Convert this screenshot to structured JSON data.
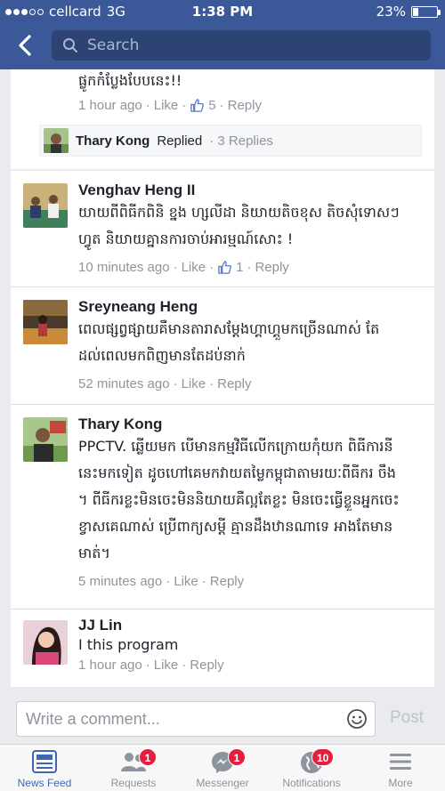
{
  "status_bar": {
    "carrier": "cellcard",
    "network": "3G",
    "time": "1:38 PM",
    "battery": "23%",
    "battery_level": 0.23
  },
  "search": {
    "placeholder": "Search"
  },
  "top_comment": {
    "text_tail": "ផ្លូកកំប្លែងបែបនេះ!!",
    "time": "1 hour ago",
    "like_label": "Like",
    "like_count": "5",
    "reply_label": "Reply",
    "replied": {
      "name": "Thary Kong",
      "action": "Replied",
      "count": "3 Replies"
    }
  },
  "comments": [
    {
      "name": "Venghav Heng II",
      "lines": [
        "យាយពីពិធីកពិនិ ខ្នង ហ្សលីដា និយាយតិចខុស តិចសុំទោសៗ",
        "ហ្វូត និយាយគ្នានការចាប់អារម្មណ៍សោះ !"
      ],
      "time": "10 minutes ago",
      "like_label": "Like",
      "like_count": "1",
      "reply_label": "Reply"
    },
    {
      "name": "Sreyneang Heng",
      "lines": [
        "ពេលផ្សព្វផ្សាយគឺមានតារាសម្តែងហ្គាហ្គួមកច្រើនណាស់ តែ",
        "ដល់ពេលមកពិញមានតែដប់នាក់"
      ],
      "time": "52 minutes ago",
      "like_label": "Like",
      "reply_label": "Reply"
    },
    {
      "name": "Thary Kong",
      "lines": [
        "PPCTV. ឆ្លើយមក បើមានកម្មវិធីលើកក្រោយកុំយក ពិធីការនី",
        "នេះមកទៀត ដូចហៅគេមកវាយតម្លៃកម្ពុជាតាមរយៈពីធីករ ចឹង",
        "។ ពីធីករខ្លះមិនចេះមិននិយាយគឺល្អតែខ្លះ មិនចេះធ្វើខ្លួនអ្នកចេះ",
        "ខ្វាសគេណាស់ ប្រើពាក្យសម្ដី គ្មានដឹងឋានណាទេ អាងតែមាន",
        "មាត់។"
      ],
      "time": "5 minutes ago",
      "like_label": "Like",
      "reply_label": "Reply"
    },
    {
      "name": "JJ Lin",
      "lines": [
        "I this program"
      ],
      "time": "1 hour ago",
      "like_label": "Like",
      "reply_label": "Reply"
    }
  ],
  "composer": {
    "placeholder": "Write a comment...",
    "post_label": "Post"
  },
  "tabs": [
    {
      "label": "News Feed",
      "icon": "news-feed-icon"
    },
    {
      "label": "Requests",
      "icon": "friend-requests-icon",
      "badge": "1"
    },
    {
      "label": "Messenger",
      "icon": "messenger-icon",
      "badge": "1"
    },
    {
      "label": "Notifications",
      "icon": "globe-icon",
      "badge": "10"
    },
    {
      "label": "More",
      "icon": "menu-icon"
    }
  ],
  "colors": {
    "brand": "#3b5998",
    "active_tab": "#4267b2",
    "badge": "#e41e3f",
    "meta": "#90949c"
  }
}
